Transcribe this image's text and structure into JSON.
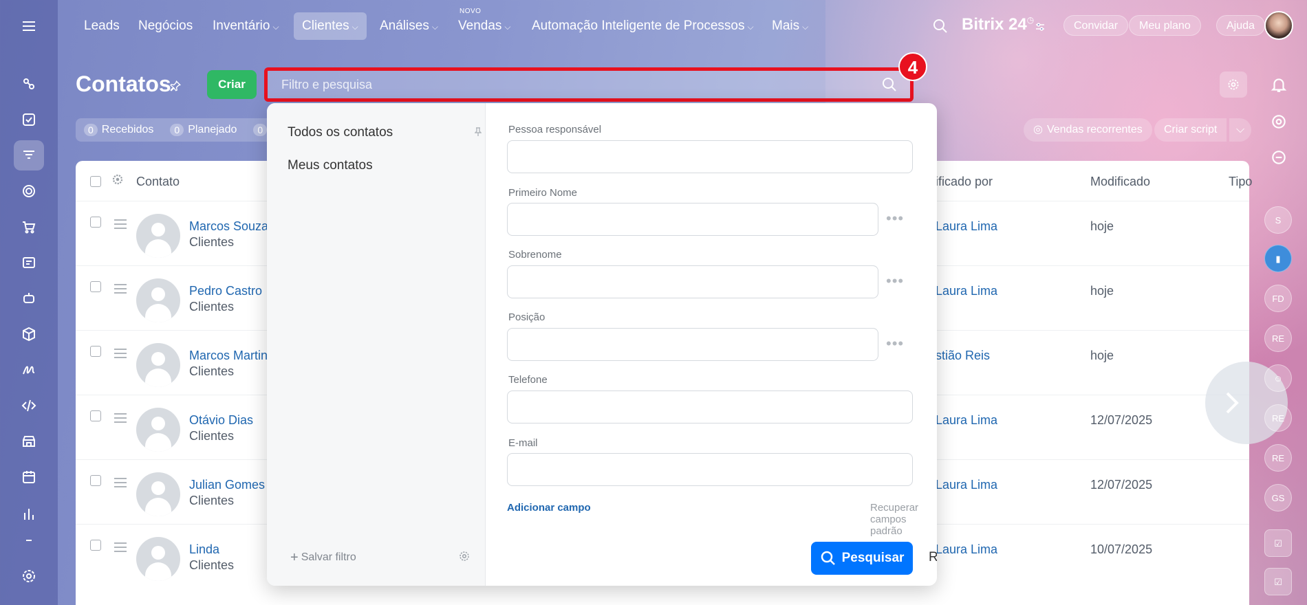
{
  "nav": {
    "items": [
      {
        "label": "Leads",
        "caret": ""
      },
      {
        "label": "Negócios",
        "caret": ""
      },
      {
        "label": "Inventário",
        "caret": "⌵"
      },
      {
        "label": "Clientes",
        "caret": "⌵"
      },
      {
        "label": "Análises",
        "caret": "⌵"
      },
      {
        "label": "Vendas",
        "caret": "⌵"
      },
      {
        "label": "Automação Inteligente de Processos",
        "caret": "⌵"
      },
      {
        "label": "Mais",
        "caret": "⌵"
      }
    ],
    "new_badge": "NOVO",
    "brand": "Bitrix 24",
    "invite": "Convidar",
    "my_plan": "Meu plano",
    "help": "Ajuda"
  },
  "page": {
    "title": "Contatos",
    "create": "Criar",
    "search_placeholder": "Filtro e pesquisa",
    "step_badge": "4"
  },
  "counters": [
    {
      "num": "0",
      "label": "Recebidos"
    },
    {
      "num": "0",
      "label": "Planejado"
    },
    {
      "num": "0",
      "label": ""
    }
  ],
  "toolbar_right": {
    "recurring_sales": "Vendas recorrentes",
    "create_script": "Criar script",
    "dropdown": "⌵"
  },
  "table": {
    "headers": {
      "contact": "Contato",
      "modified_by": "ificado por",
      "modified": "Modificado",
      "type": "Tipo"
    },
    "rows": [
      {
        "name": "Marcos Souza",
        "type": "Clientes",
        "modified_by": "Laura Lima",
        "modified": "hoje"
      },
      {
        "name": "Pedro Castro",
        "type": "Clientes",
        "modified_by": "Laura Lima",
        "modified": "hoje"
      },
      {
        "name": "Marcos Martin",
        "type": "Clientes",
        "modified_by": "stião Reis",
        "modified": "hoje"
      },
      {
        "name": "Otávio Dias",
        "type": "Clientes",
        "modified_by": "Laura Lima",
        "modified": "12/07/2025"
      },
      {
        "name": "Julian Gomes",
        "type": "Clientes",
        "modified_by": "Laura Lima",
        "modified": "12/07/2025"
      },
      {
        "name": "Linda",
        "type": "Clientes",
        "modified_by": "Laura Lima",
        "modified": "10/07/2025"
      }
    ]
  },
  "filter": {
    "presets": [
      "Todos os contatos",
      "Meus contatos"
    ],
    "save_filter": "Salvar filtro",
    "fields": [
      {
        "label": "Pessoa responsável",
        "value": ""
      },
      {
        "label": "Primeiro Nome",
        "value": ""
      },
      {
        "label": "Sobrenome",
        "value": ""
      },
      {
        "label": "Posição",
        "value": ""
      },
      {
        "label": "Telefone",
        "value": ""
      },
      {
        "label": "E-mail",
        "value": ""
      }
    ],
    "add_field": "Adicionar campo",
    "restore_fields": "Recuperar campos padrão",
    "search": "Pesquisar",
    "reset": "Redefinir"
  },
  "right_strip": [
    "S",
    "FD",
    "RE",
    "RE",
    "RE",
    "GS"
  ],
  "colors": {
    "accent": "#0075ff",
    "create": "#2fb864",
    "highlight": "#e8111f",
    "link": "#2067b0"
  }
}
